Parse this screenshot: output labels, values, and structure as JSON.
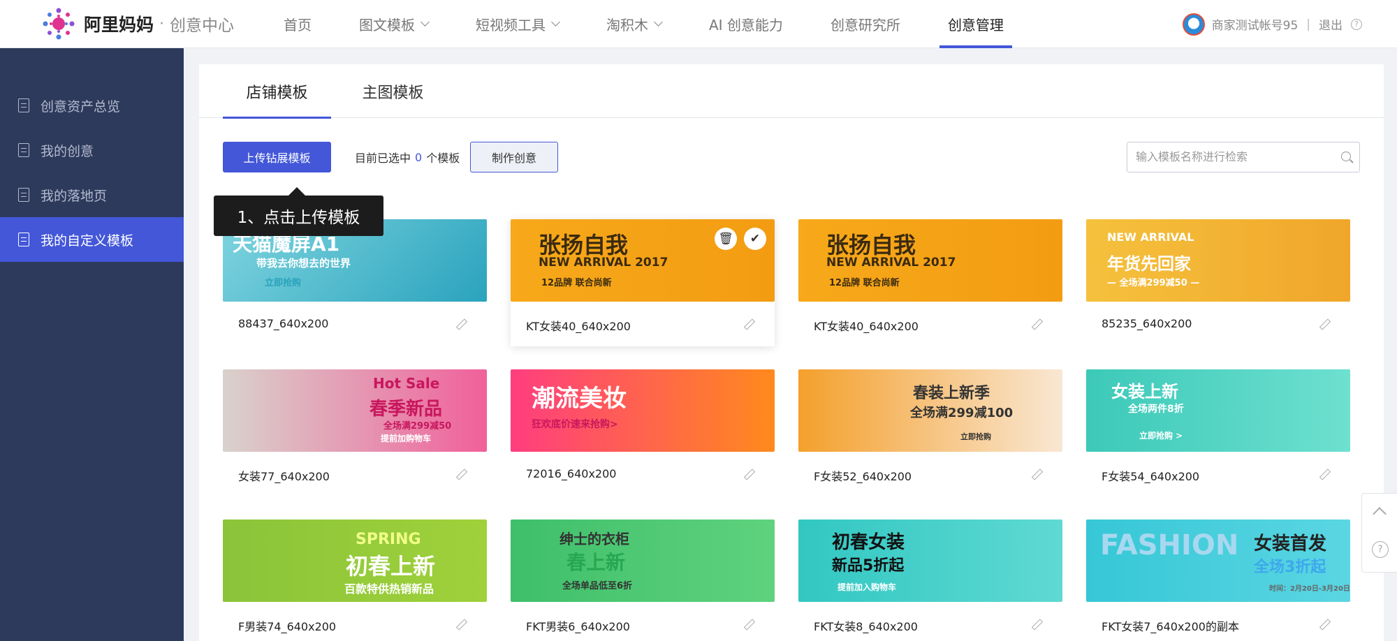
{
  "brand": {
    "name": "阿里妈妈",
    "dot": "·",
    "sub": "创意中心"
  },
  "nav": [
    {
      "label": "首页",
      "chevron": false,
      "active": false
    },
    {
      "label": "图文模板",
      "chevron": true,
      "active": false
    },
    {
      "label": "短视频工具",
      "chevron": true,
      "active": false
    },
    {
      "label": "淘积木",
      "chevron": true,
      "active": false
    },
    {
      "label": "AI 创意能力",
      "chevron": false,
      "active": false
    },
    {
      "label": "创意研究所",
      "chevron": false,
      "active": false
    },
    {
      "label": "创意管理",
      "chevron": false,
      "active": true
    }
  ],
  "user": {
    "account": "商家测试帐号95",
    "sep": "|",
    "logout": "退出",
    "help": "?"
  },
  "sidebar": [
    {
      "label": "创意资产总览",
      "active": false
    },
    {
      "label": "我的创意",
      "active": false
    },
    {
      "label": "我的落地页",
      "active": false
    },
    {
      "label": "我的自定义模板",
      "active": true
    }
  ],
  "tabs": {
    "shop": "店铺模板",
    "main": "主图模板"
  },
  "toolbar": {
    "upload": "上传钻展模板",
    "selected_prefix": "目前已选中",
    "selected_count": "0",
    "selected_suffix": "个模板",
    "make": "制作创意",
    "search_placeholder": "输入模板名称进行检索"
  },
  "tooltip": "1、点击上传模板",
  "templates": [
    {
      "name": "88437_640x200",
      "banner": {
        "bg": "linear-gradient(135deg,#7fd4df,#2aa3bd)",
        "lines": [
          "天猫魔屏A1",
          "带我去你想去的世界",
          "立即抢购"
        ]
      }
    },
    {
      "name": "KT女装40_640x200",
      "banner": {
        "bg": "linear-gradient(90deg,#f7a91a,#f39c12)",
        "lines": [
          "张扬自我",
          "NEW ARRIVAL 2017",
          "12品牌 联合尚新"
        ]
      }
    },
    {
      "name": "KT女装40_640x200",
      "banner": {
        "bg": "linear-gradient(90deg,#f7a91a,#f39c12)",
        "lines": [
          "张扬自我",
          "NEW ARRIVAL 2017",
          "12品牌 联合尚新"
        ]
      }
    },
    {
      "name": "85235_640x200",
      "banner": {
        "bg": "linear-gradient(90deg,#f5c13d,#f0a62a)",
        "lines": [
          "NEW ARRIVAL",
          "年货先回家",
          "— 全场满299减50 —"
        ]
      }
    },
    {
      "name": "女装77_640x200",
      "banner": {
        "bg": "linear-gradient(90deg,#d9d2cc,#f0609a)",
        "lines": [
          "Hot Sale",
          "春季新品",
          "全场满299减50",
          "提前加购物车"
        ]
      }
    },
    {
      "name": "72016_640x200",
      "banner": {
        "bg": "linear-gradient(90deg,#ff3d7f,#ff8a1c)",
        "lines": [
          "潮流美妆",
          "狂欢底价速来抢购>"
        ]
      }
    },
    {
      "name": "F女装52_640x200",
      "banner": {
        "bg": "linear-gradient(90deg,#f4a02c,#f9e7d3)",
        "lines": [
          "春装上新季",
          "全场满299减100",
          "立即抢购"
        ]
      }
    },
    {
      "name": "F女装54_640x200",
      "banner": {
        "bg": "linear-gradient(90deg,#3cc9b8,#6ee0d0)",
        "lines": [
          "女装上新",
          "全场两件8折",
          "立即抢购 >"
        ]
      }
    },
    {
      "name": "F男装74_640x200",
      "banner": {
        "bg": "linear-gradient(90deg,#8bc43a,#9fd13a)",
        "lines": [
          "SPRING",
          "初春上新",
          "百款特供热销新品"
        ]
      }
    },
    {
      "name": "FKT男装6_640x200",
      "banner": {
        "bg": "linear-gradient(90deg,#3fbf6a,#5fd27e)",
        "lines": [
          "绅士的衣柜",
          "春上新",
          "全场单品低至6折"
        ]
      }
    },
    {
      "name": "FKT女装8_640x200",
      "banner": {
        "bg": "linear-gradient(90deg,#32c7c2,#5fd9d3)",
        "lines": [
          "初春女装",
          "新品5折起",
          "提前加入购物车"
        ]
      }
    },
    {
      "name": "FKT女装7_640x200的副本",
      "banner": {
        "bg": "linear-gradient(90deg,#36c7d6,#5bd6e3)",
        "lines": [
          "FASHION",
          "女装首发",
          "全场3折起",
          "时间：2月20日-3月20日"
        ]
      }
    }
  ],
  "hover_icons": {
    "trash": "🗑",
    "check": "✔"
  },
  "colors": {
    "accent": "#4357d8",
    "sidebar": "#2e3a5c",
    "tooltip": "#1c1c1c"
  }
}
